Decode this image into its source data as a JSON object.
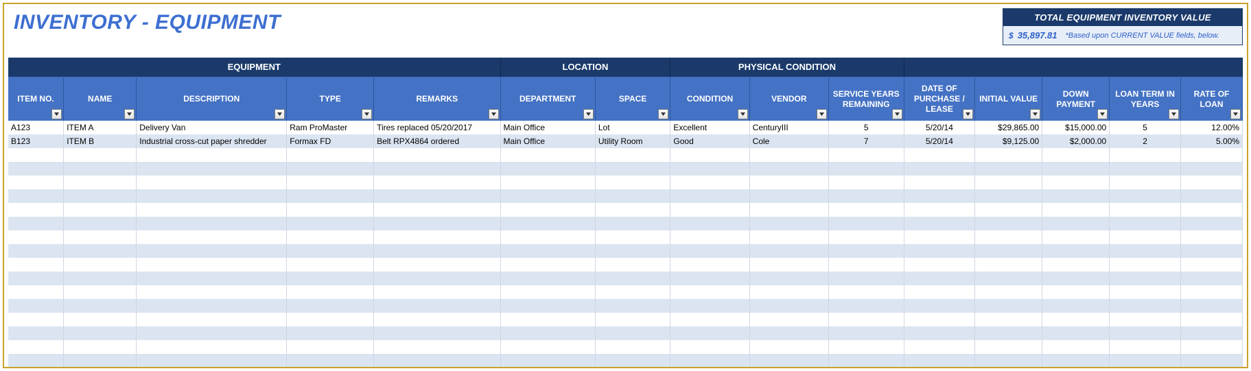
{
  "title": "INVENTORY - EQUIPMENT",
  "total": {
    "header": "TOTAL EQUIPMENT INVENTORY VALUE",
    "currency": "$",
    "value": "35,897.81",
    "note": "*Based upon CURRENT VALUE fields, below."
  },
  "groups": {
    "equipment": "EQUIPMENT",
    "location": "LOCATION",
    "condition": "PHYSICAL CONDITION"
  },
  "columns": {
    "itemno": "ITEM NO.",
    "name": "NAME",
    "desc": "DESCRIPTION",
    "type": "TYPE",
    "remarks": "REMARKS",
    "dept": "DEPARTMENT",
    "space": "SPACE",
    "cond": "CONDITION",
    "vendor": "VENDOR",
    "svc": "SERVICE YEARS REMAINING",
    "date": "DATE OF PURCHASE / LEASE",
    "initval": "INITIAL VALUE",
    "down": "DOWN PAYMENT",
    "loanterm": "LOAN TERM IN YEARS",
    "rate": "RATE OF LOAN"
  },
  "rows": [
    {
      "itemno": "A123",
      "name": "ITEM A",
      "desc": "Delivery Van",
      "type": "Ram ProMaster",
      "remarks": "Tires replaced 05/20/2017",
      "dept": "Main Office",
      "space": "Lot",
      "cond": "Excellent",
      "vendor": "CenturyIII",
      "svc": "5",
      "date": "5/20/14",
      "initval": "$29,865.00",
      "down": "$15,000.00",
      "loanterm": "5",
      "rate": "12.00%"
    },
    {
      "itemno": "B123",
      "name": "ITEM B",
      "desc": "Industrial cross-cut paper shredder",
      "type": "Formax FD",
      "remarks": "Belt RPX4864 ordered",
      "dept": "Main Office",
      "space": "Utility Room",
      "cond": "Good",
      "vendor": "Cole",
      "svc": "7",
      "date": "5/20/14",
      "initval": "$9,125.00",
      "down": "$2,000.00",
      "loanterm": "2",
      "rate": "5.00%"
    }
  ],
  "empty_row_count": 16
}
